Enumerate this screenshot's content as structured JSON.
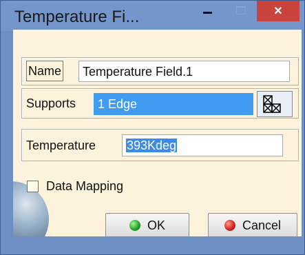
{
  "window": {
    "title": "Temperature Fi...",
    "close_glyph": "×"
  },
  "form": {
    "name_label": "Name",
    "name_value": "Temperature Field.1",
    "supports_label": "Supports",
    "supports_value": "1 Edge",
    "supports_icon": "mesh-select-icon",
    "temperature_label": "Temperature",
    "temperature_value": "393Kdeg",
    "data_mapping_label": "Data Mapping",
    "data_mapping_checked": false
  },
  "buttons": {
    "ok_label": "OK",
    "cancel_label": "Cancel"
  },
  "colors": {
    "title_bar": "#7596cb",
    "client_bg": "#fdf3dc",
    "selection": "#3f9cf0",
    "close": "#c8443d"
  }
}
